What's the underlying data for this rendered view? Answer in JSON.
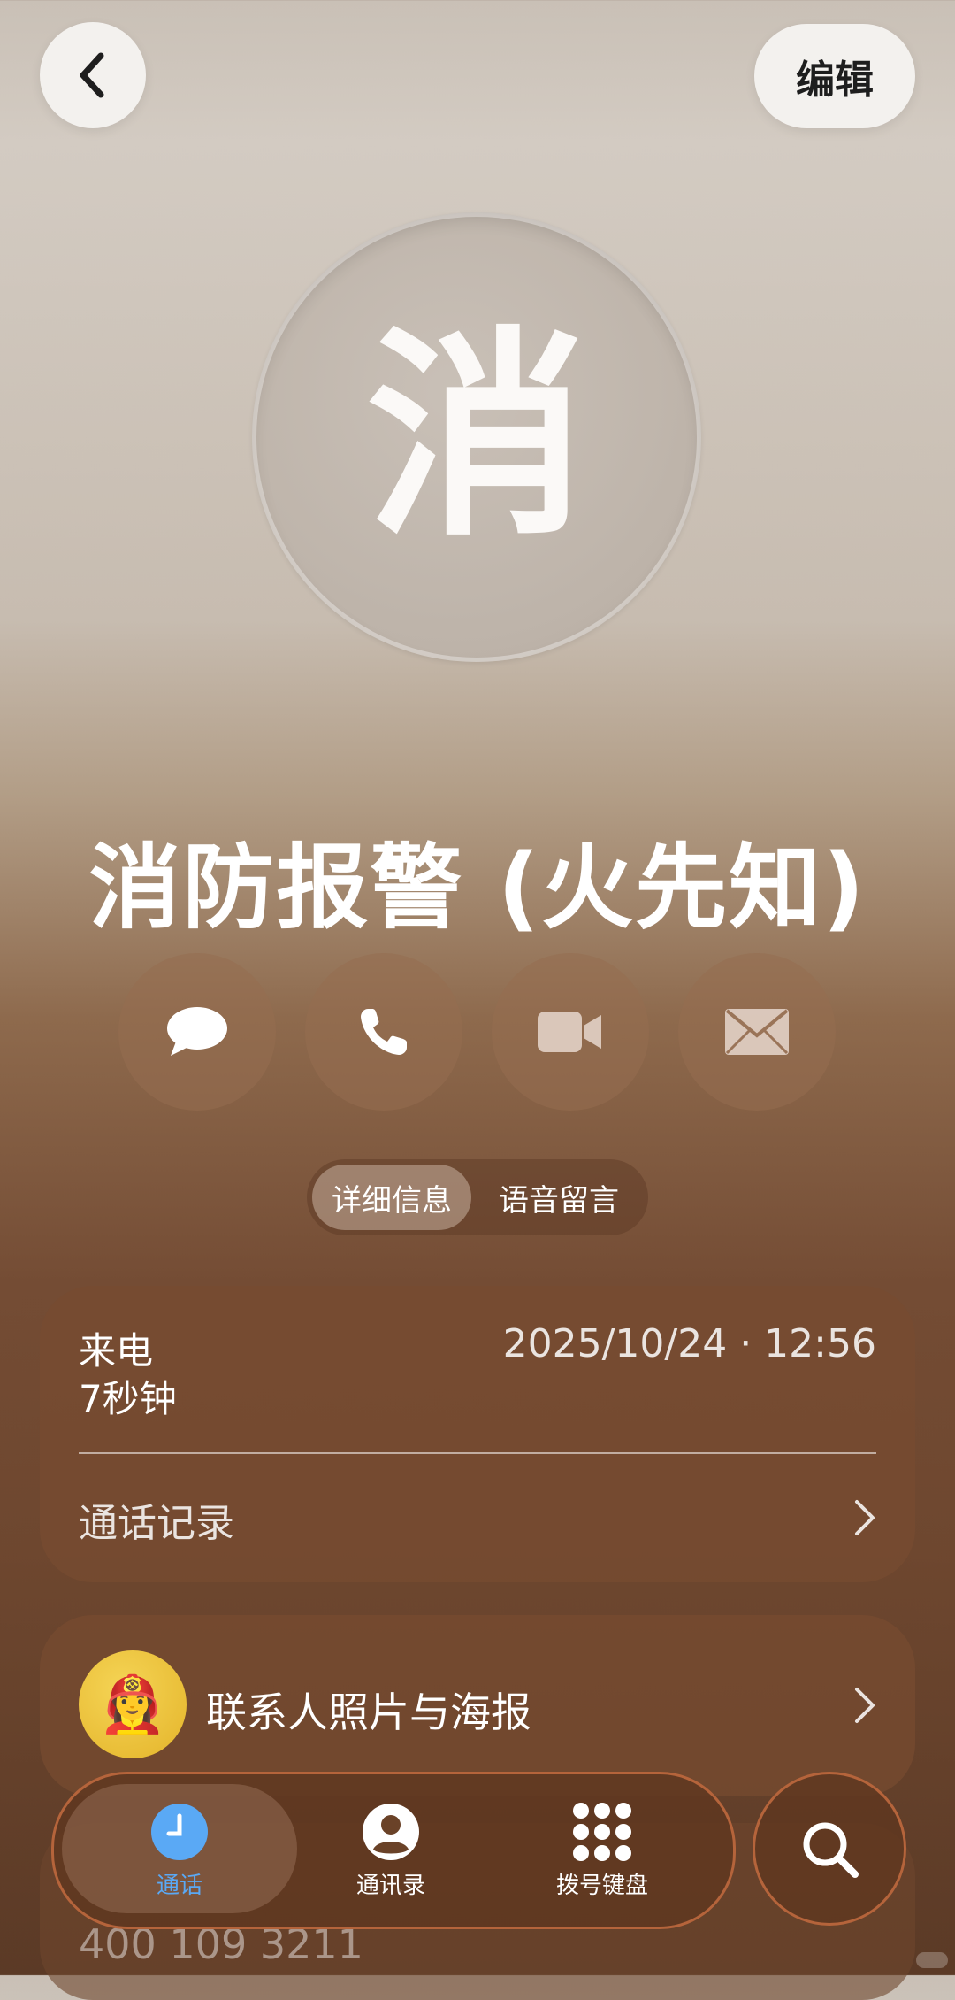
{
  "header": {
    "edit_label": "编辑"
  },
  "contact": {
    "avatar_letter": "消",
    "name": "消防报警 (火先知)"
  },
  "actions": [
    {
      "name": "message",
      "icon": "message-bubble-icon"
    },
    {
      "name": "call",
      "icon": "phone-icon"
    },
    {
      "name": "video",
      "icon": "video-camera-icon"
    },
    {
      "name": "mail",
      "icon": "mail-envelope-icon"
    }
  ],
  "tabs": {
    "details": "详细信息",
    "voicemail": "语音留言",
    "selected": "详细信息"
  },
  "call_info": {
    "type": "来电",
    "duration": "7秒钟",
    "datetime": "2025/10/24 · 12:56",
    "history_label": "通话记录"
  },
  "poster": {
    "label": "联系人照片与海报",
    "emoji": "👩‍🚒"
  },
  "phone_number": "400 109 3211",
  "bottom_nav": {
    "items": [
      {
        "label": "通话",
        "icon": "clock-icon",
        "active": true
      },
      {
        "label": "通讯录",
        "icon": "person-icon",
        "active": false
      },
      {
        "label": "拨号键盘",
        "icon": "keypad-icon",
        "active": false
      }
    ],
    "search_icon": "search-icon"
  },
  "colors": {
    "active_tab": "#5aa9f5",
    "nav_border": "#b5643b"
  }
}
